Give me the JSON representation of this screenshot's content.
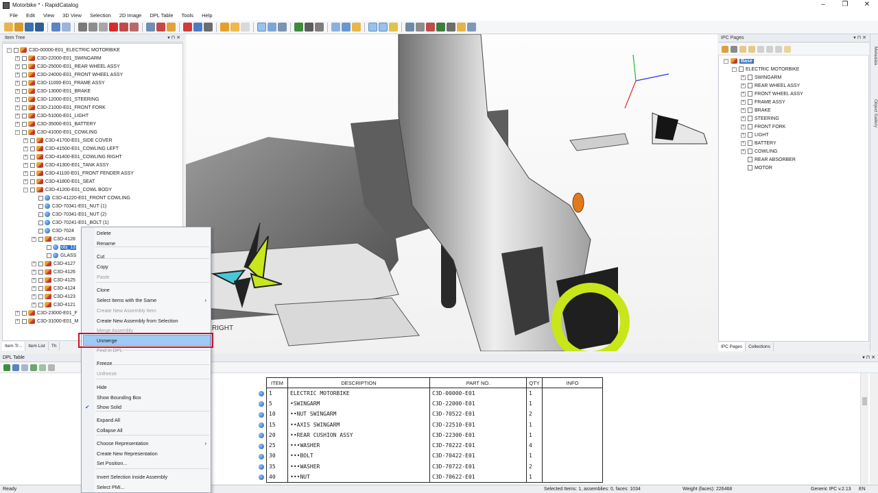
{
  "window": {
    "title": "Motorbike * - RapidCatalog",
    "controls": [
      "–",
      "❐",
      "✕"
    ]
  },
  "menu": [
    "File",
    "Edit",
    "View",
    "3D View",
    "Selection",
    "2D Image",
    "DPL Table",
    "Tools",
    "Help"
  ],
  "item_tree": {
    "header": "Item Tree",
    "nodes": [
      "C3D-00000-E01_ELECTRIC MOTORBIKE",
      "C3D-22000-E01_SWINGARM",
      "C3D-25000-E01_REAR WHEEL ASSY",
      "C3D-24000-E01_FRONT WHEEL ASSY",
      "C3D-11000-E01_FRAME ASSY",
      "C3D-13000-E01_BRAKE",
      "C3D-12000-E01_STEERING",
      "C3D-21000-E01_FRONT FORK",
      "C3D-51000-E01_LIGHT",
      "C3D-35000-E01_BATTERY",
      "C3D-41000-E01_COWLING",
      "C3D-41700-E01_SIDE COVER",
      "C3D-41500-E01_COWLING LEFT",
      "C3D-41400-E01_COWLING RIGHT",
      "C3D-41300-E01_TANK ASSY",
      "C3D-41100-E01_FRONT FENDER ASSY",
      "C3D-41800-E01_SEAT",
      "C3D-41200-E01_COWL BODY",
      "C3D-41220-E01_FRONT COWLING",
      "C3D-70341-E01_NUT (1)",
      "C3D-70341-E01_NUT (2)",
      "C3D-70241-E01_BOLT (1)",
      "C3D-7024",
      "C3D-4128",
      "obj_13",
      "GLASS",
      "C3D-4127",
      "C3D-4126",
      "C3D-4125",
      "C3D-4124",
      "C3D-4123",
      "C3D-4121",
      "C3D-23000-E01_F",
      "C3D-31000-E01_M"
    ],
    "tabs": [
      "Item Tr...",
      "Item List",
      "Th"
    ]
  },
  "context_menu": {
    "items": [
      {
        "label": "Delete",
        "enabled": true
      },
      {
        "label": "Rename",
        "enabled": true
      },
      {
        "label": "Cut",
        "enabled": true
      },
      {
        "label": "Copy",
        "enabled": true
      },
      {
        "label": "Paste",
        "enabled": false
      },
      {
        "label": "Clone",
        "enabled": true
      },
      {
        "label": "Select Items with the Same",
        "enabled": true,
        "submenu": true
      },
      {
        "label": "Create New Assembly Item",
        "enabled": false
      },
      {
        "label": "Create New Assembly from Selection",
        "enabled": true
      },
      {
        "label": "Merge Assembly",
        "enabled": false
      },
      {
        "label": "Unmerge",
        "enabled": true,
        "highlighted": true
      },
      {
        "label": "Find in DPL",
        "enabled": false
      },
      {
        "label": "Freeze",
        "enabled": true
      },
      {
        "label": "Unfreeze",
        "enabled": false
      },
      {
        "label": "Hide",
        "enabled": true
      },
      {
        "label": "Show Bounding Box",
        "enabled": true
      },
      {
        "label": "Show Solid",
        "enabled": true,
        "checked": true
      },
      {
        "label": "Expand All",
        "enabled": true
      },
      {
        "label": "Collapse All",
        "enabled": true
      },
      {
        "label": "Choose Representation",
        "enabled": true,
        "submenu": true
      },
      {
        "label": "Create New Representation",
        "enabled": true
      },
      {
        "label": "Set Position...",
        "enabled": true
      },
      {
        "label": "Invert Selection inside Assembly",
        "enabled": true
      },
      {
        "label": "Select PMI...",
        "enabled": true
      }
    ],
    "submenu_glyph": "›",
    "check_glyph": "✔"
  },
  "ipc_pages": {
    "header": "IPC Pages",
    "root": "Base",
    "assembly": "ELECTRIC MOTORBIKE",
    "pages": [
      "SWINGARM",
      "REAR WHEEL ASSY",
      "FRONT WHEEL ASSY",
      "FRAME ASSY",
      "BRAKE",
      "STEERING",
      "FRONT FORK",
      "LIGHT",
      "BATTERY",
      "COWLING",
      "REAR ABSORBER",
      "MOTOR"
    ],
    "tabs": [
      "IPC Pages",
      "Collections"
    ]
  },
  "side_tabs": [
    "Metadata",
    "Object Gallery"
  ],
  "dpl": {
    "header": "DPL Table",
    "columns": [
      "ITEM",
      "DESCRIPTION",
      "PART NO.",
      "QTY",
      "INFO"
    ],
    "rows": [
      [
        "1",
        "ELECTRIC MOTORBIKE",
        "C3D-00000-E01",
        "1",
        ""
      ],
      [
        "5",
        "•SWINGARM",
        "C3D-22000-E01",
        "1",
        ""
      ],
      [
        "10",
        "••NUT SWINGARM",
        "C3D-70522-E01",
        "2",
        ""
      ],
      [
        "15",
        "••AXIS SWINGARM",
        "C3D-22510-E01",
        "1",
        ""
      ],
      [
        "20",
        "••REAR CUSHION ASSY",
        "C3D-22300-E01",
        "1",
        ""
      ],
      [
        "25",
        "•••WASHER",
        "C3D-70222-E01",
        "4",
        ""
      ],
      [
        "30",
        "•••BOLT",
        "C3D-70422-E01",
        "1",
        ""
      ],
      [
        "35",
        "•••WASHER",
        "C3D-70722-E01",
        "2",
        ""
      ],
      [
        "40",
        "•••NUT",
        "C3D-70622-E01",
        "1",
        ""
      ]
    ]
  },
  "viewport": {
    "decal_text": "RIGHT"
  },
  "status": {
    "left": "Ready",
    "selection": "Selected Items: 1, assemblies: 0, faces: 1034",
    "weight": "Weight (faces): 226468",
    "ipc": "Generic IPC v.2.13",
    "lang": "EN"
  },
  "colors": {
    "accent": "#3373c4",
    "highlight": "#9ecbf5",
    "annotation": "#c8102e",
    "lime": "#c8e61a",
    "cyan": "#49c7d6"
  }
}
